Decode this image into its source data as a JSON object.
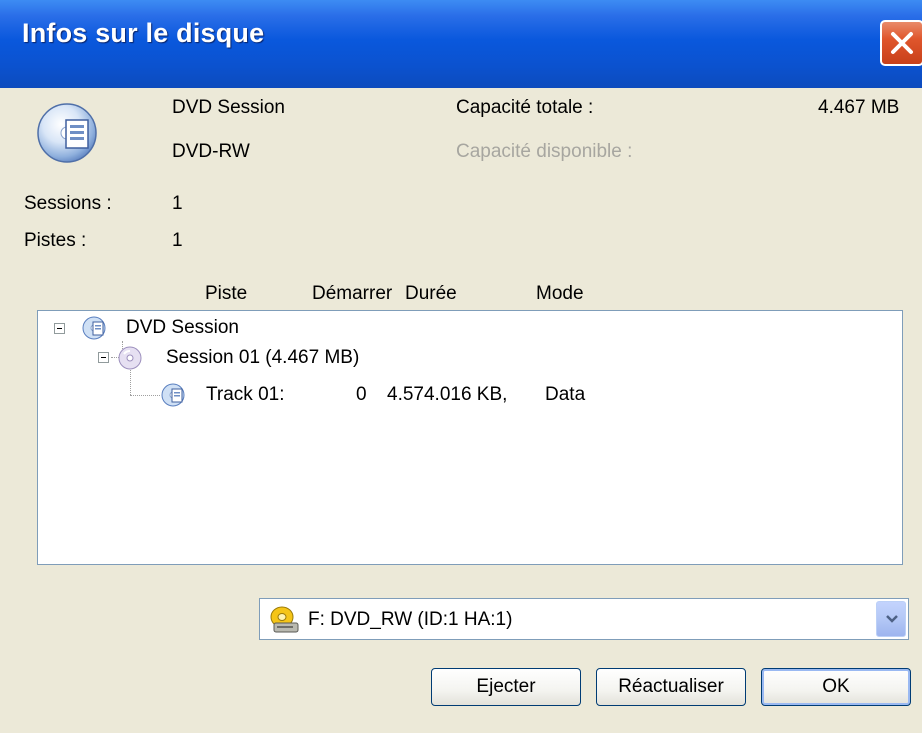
{
  "window": {
    "title": "Infos sur le disque"
  },
  "disc": {
    "name": "DVD Session",
    "type": "DVD-RW",
    "total_capacity_label": "Capacité totale :",
    "total_capacity_value": "4.467 MB",
    "available_capacity_label": "Capacité disponible :"
  },
  "stats": {
    "sessions_label": "Sessions :",
    "sessions_value": "1",
    "tracks_label": "Pistes :",
    "tracks_value": "1"
  },
  "columns": [
    "Piste",
    "Démarrer",
    "Durée",
    "Mode"
  ],
  "tree": {
    "root": "DVD Session",
    "session": "Session 01 (4.467 MB)",
    "track": {
      "name": "Track 01:",
      "start": "0",
      "duration": "4.574.016 KB,",
      "mode": "Data"
    }
  },
  "drive_select": {
    "value": "F: DVD_RW  (ID:1 HA:1)"
  },
  "buttons": {
    "eject": "Ejecter",
    "refresh": "Réactualiser",
    "ok": "OK"
  },
  "colors": {
    "titlebar": "#0a58dd",
    "window_bg": "#ece9d8",
    "close": "#e0562c",
    "disabled_text": "#a7a6a0"
  }
}
